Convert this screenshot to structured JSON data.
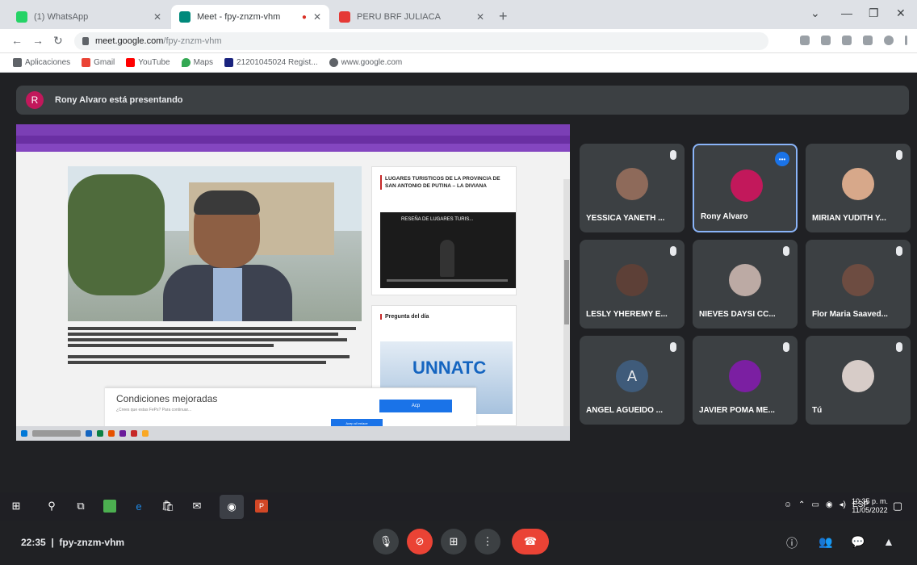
{
  "browser": {
    "tabs": [
      {
        "label": "(1) WhatsApp",
        "color": "#25d366"
      },
      {
        "label": "Meet - fpy-znzm-vhm",
        "color": "#00897b"
      },
      {
        "label": "PERU BRF JULIACA",
        "color": "#e53935"
      }
    ],
    "url_host": "meet.google.com",
    "url_path": "/fpy-znzm-vhm",
    "bookmarks": [
      {
        "label": "Aplicaciones",
        "color": "#5f6368"
      },
      {
        "label": "Gmail",
        "color": "#ea4335"
      },
      {
        "label": "YouTube",
        "color": "#ff0000"
      },
      {
        "label": "Maps",
        "color": "#34a853"
      },
      {
        "label": "21201045024 Regist...",
        "color": "#1a237e"
      },
      {
        "label": "www.google.com",
        "color": "#5f6368"
      }
    ]
  },
  "meet": {
    "presenting_label": "Rony Alvaro está presentando",
    "meeting_code": "fpy-znzm-vhm",
    "clock": "22:35",
    "participants": [
      {
        "name": "YESSICA YANETH ...",
        "avatar_color": "#8e6a5a"
      },
      {
        "name": "Rony Alvaro",
        "avatar_color": "#c2185b"
      },
      {
        "name": "MIRIAN YUDITH Y...",
        "avatar_color": "#d7a88a"
      },
      {
        "name": "LESLY YHEREMY E...",
        "avatar_color": "#5d4037"
      },
      {
        "name": "NIEVES DAYSI CC...",
        "avatar_color": "#bcaaa4"
      },
      {
        "name": "Flor Maria Saaved...",
        "avatar_color": "#6d4c41"
      },
      {
        "name": "ANGEL AGUEIDO ...",
        "avatar_color": "#3f5b7a",
        "letter": "A"
      },
      {
        "name": "JAVIER POMA ME...",
        "avatar_color": "#7b1fa2"
      },
      {
        "name": "Tú",
        "avatar_color": "#d7ccc8"
      }
    ]
  },
  "shared_screen": {
    "sidebar_title": "LUGARES TURISTICOS DE LA PROVINCIA DE SAN ANTONIO DE PUTINA – LA DIVIANA",
    "video_title": "RESEÑA DE LUGARES TURIS...",
    "question_title": "Pregunta del día",
    "question_image_text": "UNNATC",
    "cookie_title": "Condiciones mejoradas",
    "cookie_text": "¿Crees que estas FePs? Para continuar...",
    "cookie_accept": "Acp",
    "cookie_config": "Acep all enlace"
  },
  "taskbar": {
    "lang": "ESP",
    "time": "10:35 p. m.",
    "date": "11/05/2022"
  }
}
